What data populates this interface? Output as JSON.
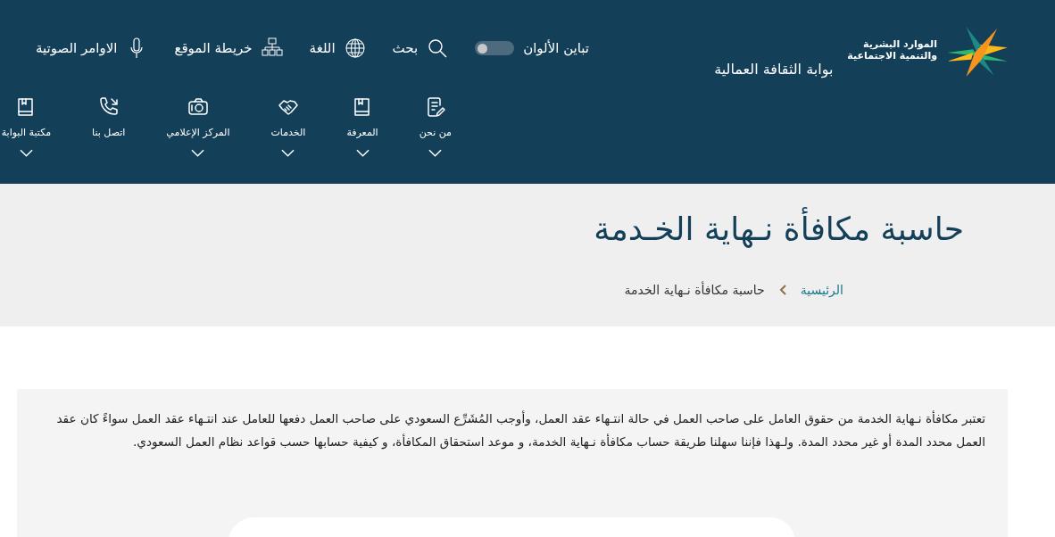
{
  "header": {
    "logo_text": [
      "الموارد البشرية",
      "والتنمية الاجتماعية"
    ],
    "portal_title": "بوابة الثقافة العمالية",
    "contrast_toggle": {
      "label": "تباين الألوان",
      "on": false
    },
    "utility_links": [
      {
        "kind": "search",
        "label": "بحث"
      },
      {
        "kind": "language",
        "label": "اللغة"
      },
      {
        "kind": "sitemap",
        "label": "خريطة الموقع"
      },
      {
        "kind": "voice",
        "label": "الاوامر الصوتية"
      }
    ],
    "nav": [
      {
        "kind": "about",
        "label": "من نحن",
        "expandable": true
      },
      {
        "kind": "knowledge",
        "label": "المعرفة",
        "expandable": true
      },
      {
        "kind": "services",
        "label": "الخدمات",
        "expandable": true
      },
      {
        "kind": "media",
        "label": "المركز الإعلامي",
        "expandable": true
      },
      {
        "kind": "contact",
        "label": "اتصل بنا",
        "expandable": false
      },
      {
        "kind": "library",
        "label": "مكتبة البوابة",
        "expandable": true
      }
    ]
  },
  "page_title": "حاسبة مكافأة نـهاية الخـدمة",
  "breadcrumb": [
    {
      "label": "الرئيسية",
      "link": true
    },
    {
      "label": "حاسبة مكافأة نـهاية الخدمة",
      "link": false
    }
  ],
  "intro": "تعتبر مكافأة نـهاية الخدمة من حقوق العامل على صاحب العمل في حالة انتـهاء عقد العمل، وأوجب المُشَرِّع السعودي على صاحب العمل دفعها للعامل عند انتـهاء عقد العمل سواءً كان عقد العمل محدد المدة أو غير محدد المدة. ولـهذا فإننا سهلنا طريقة حساب مكافأة نـهاية الخدمة، و موعد استحقاق المكافأة، و كيفية حسابها حسب قواعد نظام العمل السعودي."
}
